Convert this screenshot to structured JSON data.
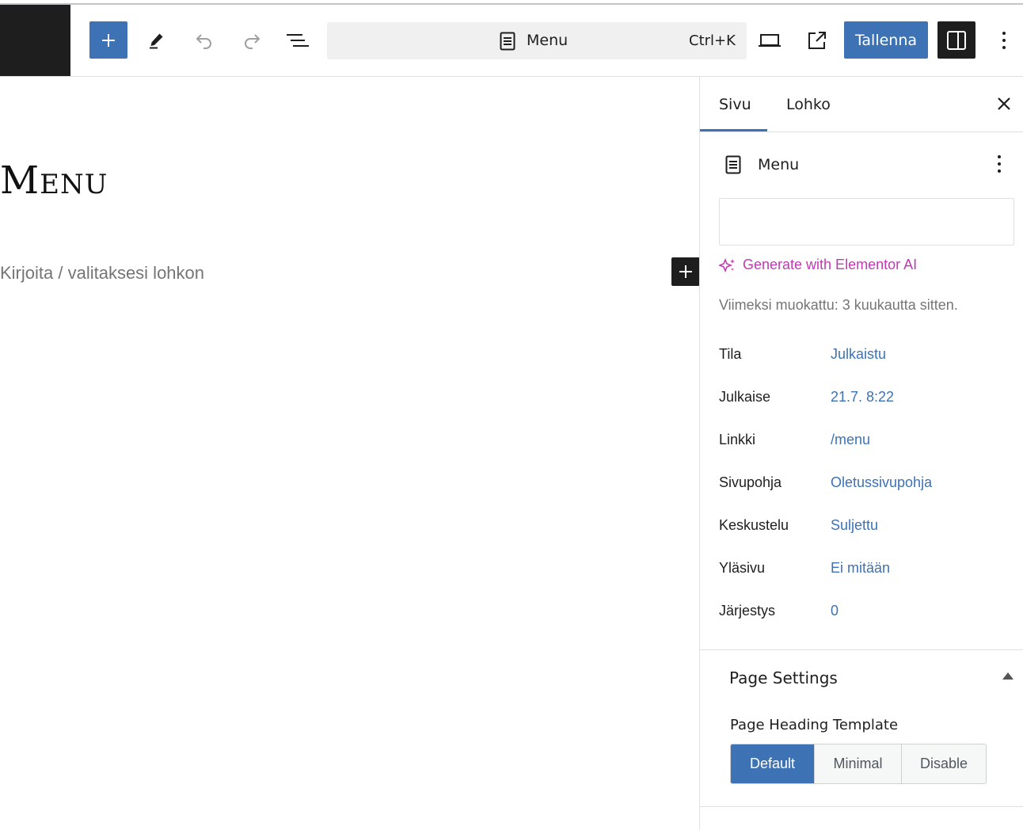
{
  "toolbar": {
    "add_icon": "plus-icon",
    "tools_icon": "pencil-icon",
    "undo_icon": "undo-icon",
    "redo_icon": "redo-icon",
    "list_view_icon": "list-view-icon",
    "command_bar": {
      "title": "Menu",
      "shortcut": "Ctrl+K",
      "icon": "page-icon"
    },
    "view_icon": "desktop-icon",
    "view_external_icon": "external-link-icon",
    "save_label": "Tallenna",
    "settings_icon": "sidebar-icon",
    "more_icon": "more-vertical-icon"
  },
  "editor": {
    "page_title": "Menu",
    "block_placeholder": "Kirjoita / valitaksesi lohkon"
  },
  "sidebar": {
    "tabs": [
      {
        "label": "Sivu",
        "active": true
      },
      {
        "label": "Lohko",
        "active": false
      }
    ],
    "document": {
      "title": "Menu",
      "ai_link": "Generate with Elementor AI",
      "last_edited": "Viimeksi muokattu: 3 kuukautta sitten."
    },
    "properties": [
      {
        "label": "Tila",
        "value": "Julkaistu"
      },
      {
        "label": "Julkaise",
        "value": "21.7. 8:22"
      },
      {
        "label": "Linkki",
        "value": "/menu"
      },
      {
        "label": "Sivupohja",
        "value": "Oletussivupohja"
      },
      {
        "label": "Keskustelu",
        "value": "Suljettu"
      },
      {
        "label": "Yläsivu",
        "value": "Ei mitään"
      },
      {
        "label": "Järjestys",
        "value": "0"
      }
    ],
    "page_settings": {
      "title": "Page Settings",
      "heading_template_label": "Page Heading Template",
      "options": [
        "Default",
        "Minimal",
        "Disable"
      ],
      "selected": "Default"
    }
  },
  "colors": {
    "accent": "#3d72b4",
    "ai": "#c03ab4",
    "dark": "#1e1e1e"
  }
}
